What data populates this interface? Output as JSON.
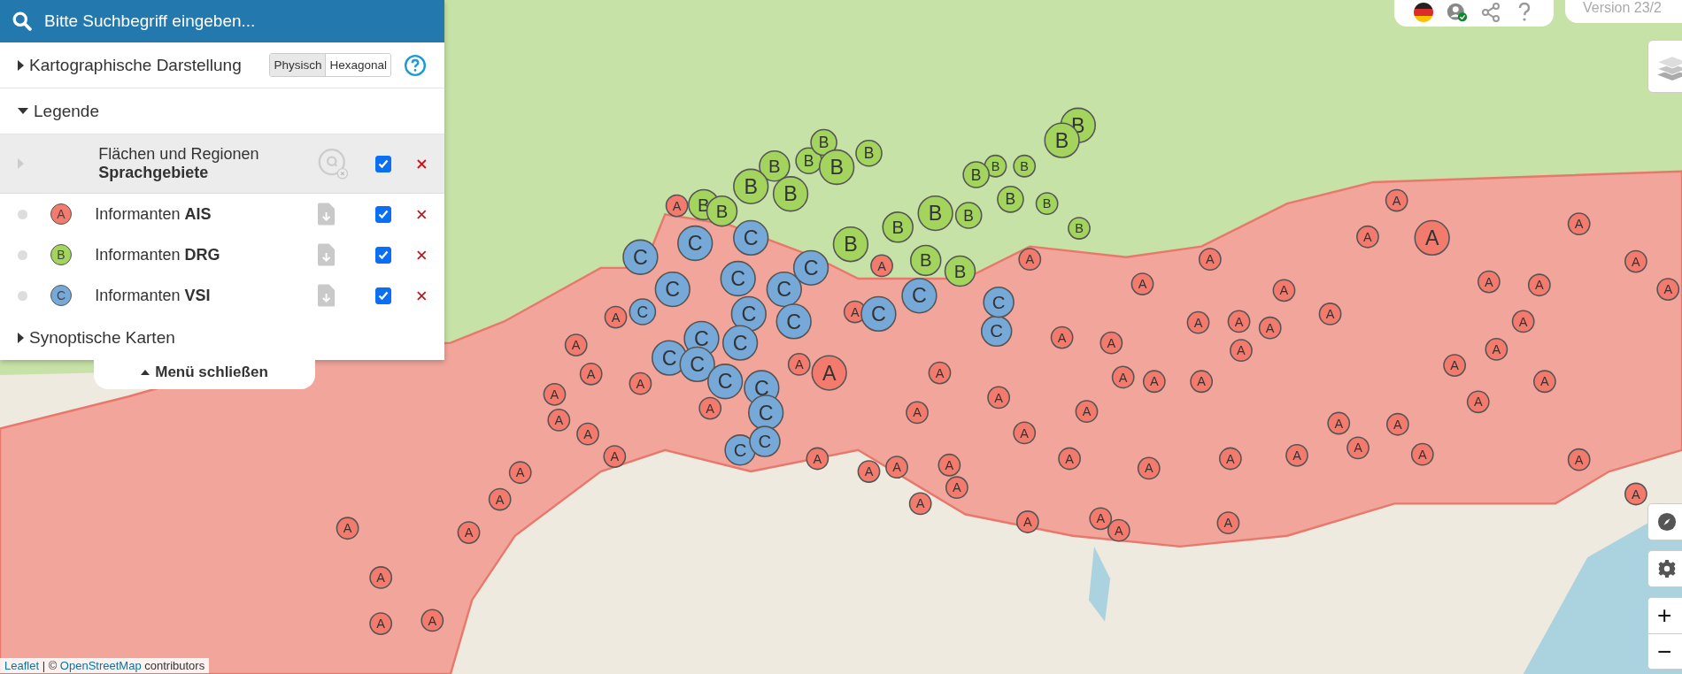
{
  "search": {
    "placeholder": "Bitte Suchbegriff eingeben..."
  },
  "display": {
    "label": "Kartographische Darstellung",
    "expanded": false,
    "modes": [
      {
        "label": "Physisch",
        "selected": true
      },
      {
        "label": "Hexagonal",
        "selected": false
      }
    ]
  },
  "legend": {
    "label": "Legende",
    "expanded": true,
    "items": [
      {
        "kind": "area",
        "line1": "Flächen und Regionen",
        "title": "Sprachgebiete",
        "checked": true
      },
      {
        "kind": "points",
        "symbol": "A",
        "color": "#f37b6e",
        "prefix": "Informanten",
        "title": "AIS",
        "checked": true
      },
      {
        "kind": "points",
        "symbol": "B",
        "color": "#a3d45e",
        "prefix": "Informanten",
        "title": "DRG",
        "checked": true
      },
      {
        "kind": "points",
        "symbol": "C",
        "color": "#76a9d8",
        "prefix": "Informanten",
        "title": "VSI",
        "checked": true
      }
    ]
  },
  "synoptic": {
    "label": "Synoptische Karten",
    "expanded": false
  },
  "close_menu": "Menü schließen",
  "top_bar": {
    "version": "Version 23/2"
  },
  "zoom": {
    "in": "+",
    "out": "−"
  },
  "attribution": [
    {
      "kind": "link",
      "text": "Leaflet"
    },
    {
      "kind": "text",
      "text": " | © "
    },
    {
      "kind": "link",
      "text": "OpenStreetMap"
    },
    {
      "kind": "text",
      "text": " contributors"
    }
  ],
  "map": {
    "layers": [
      {
        "color": "#f37b6e",
        "markers": [
          "A",
          "A",
          "A",
          "A",
          "A",
          "A",
          "A",
          "A",
          "A",
          "A",
          "A",
          "A",
          "A",
          "A",
          "A",
          "A",
          "A",
          "A",
          "A",
          "A",
          "A",
          "A",
          "A",
          "A",
          "A",
          "A",
          "A",
          "A",
          "A",
          "A",
          "A",
          "A",
          "A",
          "A",
          "A",
          "A",
          "A",
          "A",
          "A",
          "A",
          "A",
          "A",
          "A",
          "A",
          "A",
          "A",
          "A",
          "A",
          "A",
          "A",
          "A",
          "A",
          "A",
          "A",
          "A",
          "A",
          "A",
          "A",
          "A",
          "A",
          "A",
          "A",
          "A",
          "A",
          "A",
          "A",
          "A",
          "A",
          "A",
          "A",
          "A",
          "A",
          "A"
        ]
      },
      {
        "color": "#a3d45e",
        "markers": [
          "B",
          "B",
          "B",
          "B",
          "B",
          "B",
          "B",
          "B",
          "B",
          "B",
          "B",
          "B",
          "B",
          "B",
          "B",
          "B",
          "B",
          "B",
          "B",
          "B",
          "B",
          "B",
          "B"
        ]
      },
      {
        "color": "#76a9d8",
        "markers": [
          "C",
          "C",
          "C",
          "C",
          "C",
          "C",
          "C",
          "C",
          "C",
          "C",
          "C",
          "C",
          "C",
          "C",
          "C",
          "C",
          "C",
          "C",
          "C",
          "C",
          "C",
          "C",
          "C"
        ]
      }
    ]
  }
}
